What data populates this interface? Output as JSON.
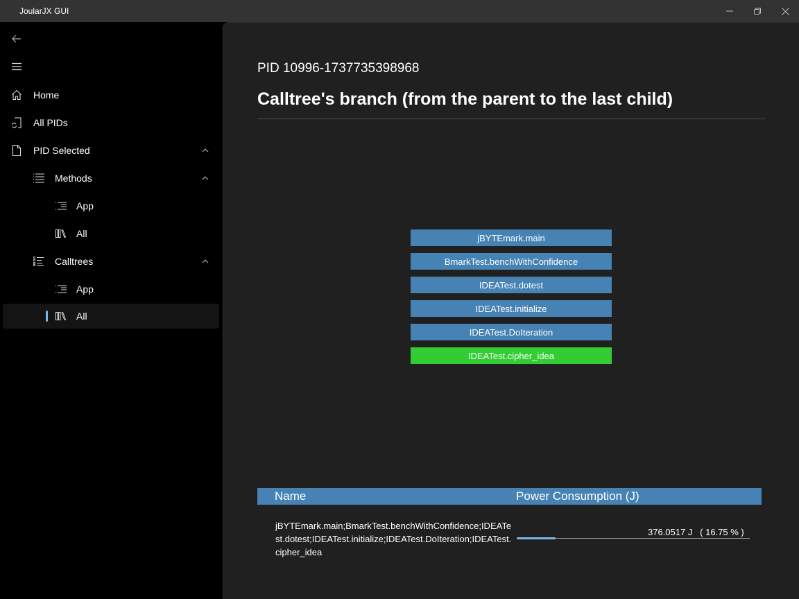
{
  "window": {
    "title": "JoularJX GUI",
    "controls": {
      "minimize": "minimize-icon",
      "maximize": "maximize-icon",
      "close": "close-icon"
    }
  },
  "sidebar": {
    "back_icon": "back-arrow-icon",
    "menu_icon": "hamburger-icon",
    "items": [
      {
        "label": "Home",
        "icon": "home-icon",
        "level": 0
      },
      {
        "label": "All PIDs",
        "icon": "pid-list-icon",
        "level": 0
      },
      {
        "label": "PID Selected",
        "icon": "document-icon",
        "level": 0,
        "expanded": true
      },
      {
        "label": "Methods",
        "icon": "list-icon",
        "level": 1,
        "expanded": true
      },
      {
        "label": "App",
        "icon": "indent-list-icon",
        "level": 2
      },
      {
        "label": "All",
        "icon": "library-icon",
        "level": 2
      },
      {
        "label": "Calltrees",
        "icon": "bullet-list-icon",
        "level": 1,
        "expanded": true
      },
      {
        "label": "App",
        "icon": "indent-list-icon",
        "level": 2
      },
      {
        "label": "All",
        "icon": "library-icon",
        "level": 2,
        "selected": true
      }
    ]
  },
  "main": {
    "pid": "PID 10996-1737735398968",
    "title": "Calltree's branch (from the parent to the last child)",
    "branch": [
      {
        "label": "jBYTEmark.main",
        "color": "#4682b4"
      },
      {
        "label": "BmarkTest.benchWithConfidence",
        "color": "#4682b4"
      },
      {
        "label": "IDEATest.dotest",
        "color": "#4682b4"
      },
      {
        "label": "IDEATest.initialize",
        "color": "#4682b4"
      },
      {
        "label": "IDEATest.DoIteration",
        "color": "#4682b4"
      },
      {
        "label": "IDEATest.cipher_idea",
        "color": "#32cd32"
      }
    ],
    "table": {
      "headers": {
        "name": "Name",
        "power": "Power Consumption (J)"
      },
      "rows": [
        {
          "name": "jBYTEmark.main;BmarkTest.benchWithConfidence;IDEATest.dotest;IDEATest.initialize;IDEATest.DoIteration;IDEATest.cipher_idea",
          "value_text": "376.0517 J   ( 16.75 % )",
          "energy_joules": 376.0517,
          "percent": 16.75
        }
      ]
    }
  },
  "colors": {
    "accent": "#76b9ed",
    "node_blue": "#4682b4",
    "node_leaf": "#32cd32",
    "main_bg": "#202020",
    "sidebar_bg": "#000000",
    "titlebar_bg": "#333333"
  }
}
